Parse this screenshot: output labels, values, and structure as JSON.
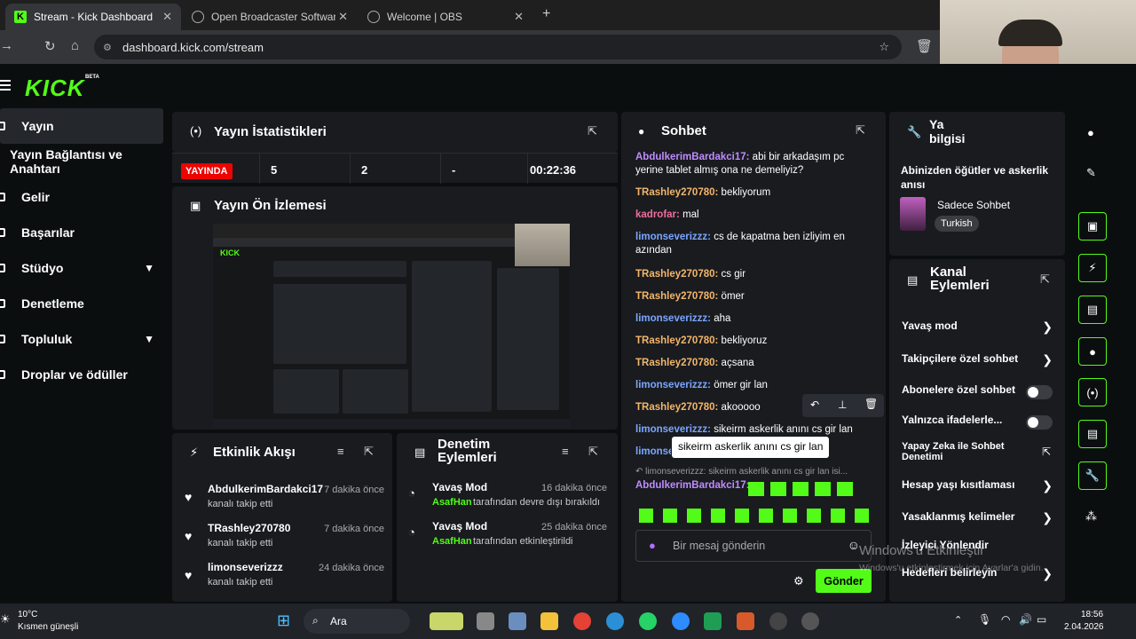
{
  "browser": {
    "tabs": [
      {
        "label": "Stream - Kick Dashboard"
      },
      {
        "label": "Open Broadcaster Software | OI"
      },
      {
        "label": "Welcome | OBS"
      }
    ],
    "url": "dashboard.kick.com/stream"
  },
  "header": {
    "logo": "KICK",
    "beta": "BETA"
  },
  "sidebar": {
    "items": [
      {
        "label": "Yayın"
      },
      {
        "label": "Yayın Bağlantısı ve Anahtarı"
      },
      {
        "label": "Gelir"
      },
      {
        "label": "Başarılar"
      },
      {
        "label": "Stüdyo"
      },
      {
        "label": "Denetleme"
      },
      {
        "label": "Topluluk"
      },
      {
        "label": "Droplar ve ödüller"
      }
    ]
  },
  "stats": {
    "title": "Yayın İstatistikleri",
    "live_badge": "YAYINDA",
    "viewers": "5",
    "followers": "2",
    "subs": "-",
    "duration": "00:22:36"
  },
  "preview": {
    "title": "Yayın Ön İzlemesi"
  },
  "activity": {
    "title": "Etkinlik Akışı",
    "items": [
      {
        "name": "AbdulkerimBardakci17",
        "sub": "kanalı takip etti",
        "time": "7 dakika önce"
      },
      {
        "name": "TRashley270780",
        "sub": "kanalı takip etti",
        "time": "7 dakika önce"
      },
      {
        "name": "limonseverizzz",
        "sub": "kanalı takip etti",
        "time": "24 dakika önce"
      }
    ]
  },
  "moderation": {
    "title": "Denetim Eylemleri",
    "items": [
      {
        "name": "Yavaş Mod",
        "user": "AsafHan",
        "action": "tarafından devre dışı bırakıldı",
        "time": "16 dakika önce"
      },
      {
        "name": "Yavaş Mod",
        "user": "AsafHan",
        "action": "tarafından etkinleştirildi",
        "time": "25 dakika önce"
      }
    ]
  },
  "chat": {
    "title": "Sohbet",
    "messages": [
      {
        "user": "AbdulkerimBardakci17:",
        "text": "abi bir arkadaşım pc yerine tablet almış ona ne demeliyiz?"
      },
      {
        "user": "TRashley270780:",
        "text": "bekliyorum"
      },
      {
        "user": "kadrofar:",
        "text": "mal"
      },
      {
        "user": "limonseverizzz:",
        "text": "cs de kapatma ben izliyim en azından"
      },
      {
        "user": "TRashley270780:",
        "text": "cs gir"
      },
      {
        "user": "TRashley270780:",
        "text": "ömer"
      },
      {
        "user": "limonseverizzz:",
        "text": "aha"
      },
      {
        "user": "TRashley270780:",
        "text": "bekliyoruz"
      },
      {
        "user": "TRashley270780:",
        "text": "açsana"
      },
      {
        "user": "limonseverizzz:",
        "text": "ömer gir lan"
      },
      {
        "user": "TRashley270780:",
        "text": "akooooo"
      },
      {
        "user": "limonseverizzz:",
        "text": "sikeirm askerlik anını cs gir lan"
      },
      {
        "user": "limonse",
        "text": ""
      }
    ],
    "tooltip": "sikeirm askerlik anını cs gir lan",
    "reply_preview": "limonseverizzz: sikeirm askerlik anını cs gir lan isi...",
    "reply_user": "AbdulkerimBardakci17:",
    "input_placeholder": "Bir mesaj gönderin",
    "send_label": "Gönder"
  },
  "stream_info": {
    "title_short": "Ya bilgisi",
    "stream_title": "Abinizden öğütler ve askerlik anısı",
    "category": "Sadece Sohbet",
    "tag": "Turkish"
  },
  "channel_actions": {
    "title": "Kanal Eylemleri",
    "items": [
      {
        "label": "Yavaş mod"
      },
      {
        "label": "Takipçilere özel sohbet"
      },
      {
        "label": "Abonelere özel sohbet"
      },
      {
        "label": "Yalnızca ifadelerle..."
      },
      {
        "label": "Yapay Zeka ile Sohbet Denetimi"
      },
      {
        "label": "Hesap yaşı kısıtlaması"
      },
      {
        "label": "Yasaklanmış kelimeler"
      },
      {
        "label": "İzleyici Yönlendir"
      },
      {
        "label": "Hedefleri belirleyin"
      }
    ]
  },
  "watermark": {
    "line1": "Windows'u Etkinleştir",
    "line2": "Windows'u etkinleştirmek için Ayarlar'a gidin."
  },
  "taskbar": {
    "weather_temp": "10°C",
    "weather_desc": "Kısmen güneşli",
    "search": "Ara",
    "time": "18:56",
    "date": "2.04.2026"
  }
}
